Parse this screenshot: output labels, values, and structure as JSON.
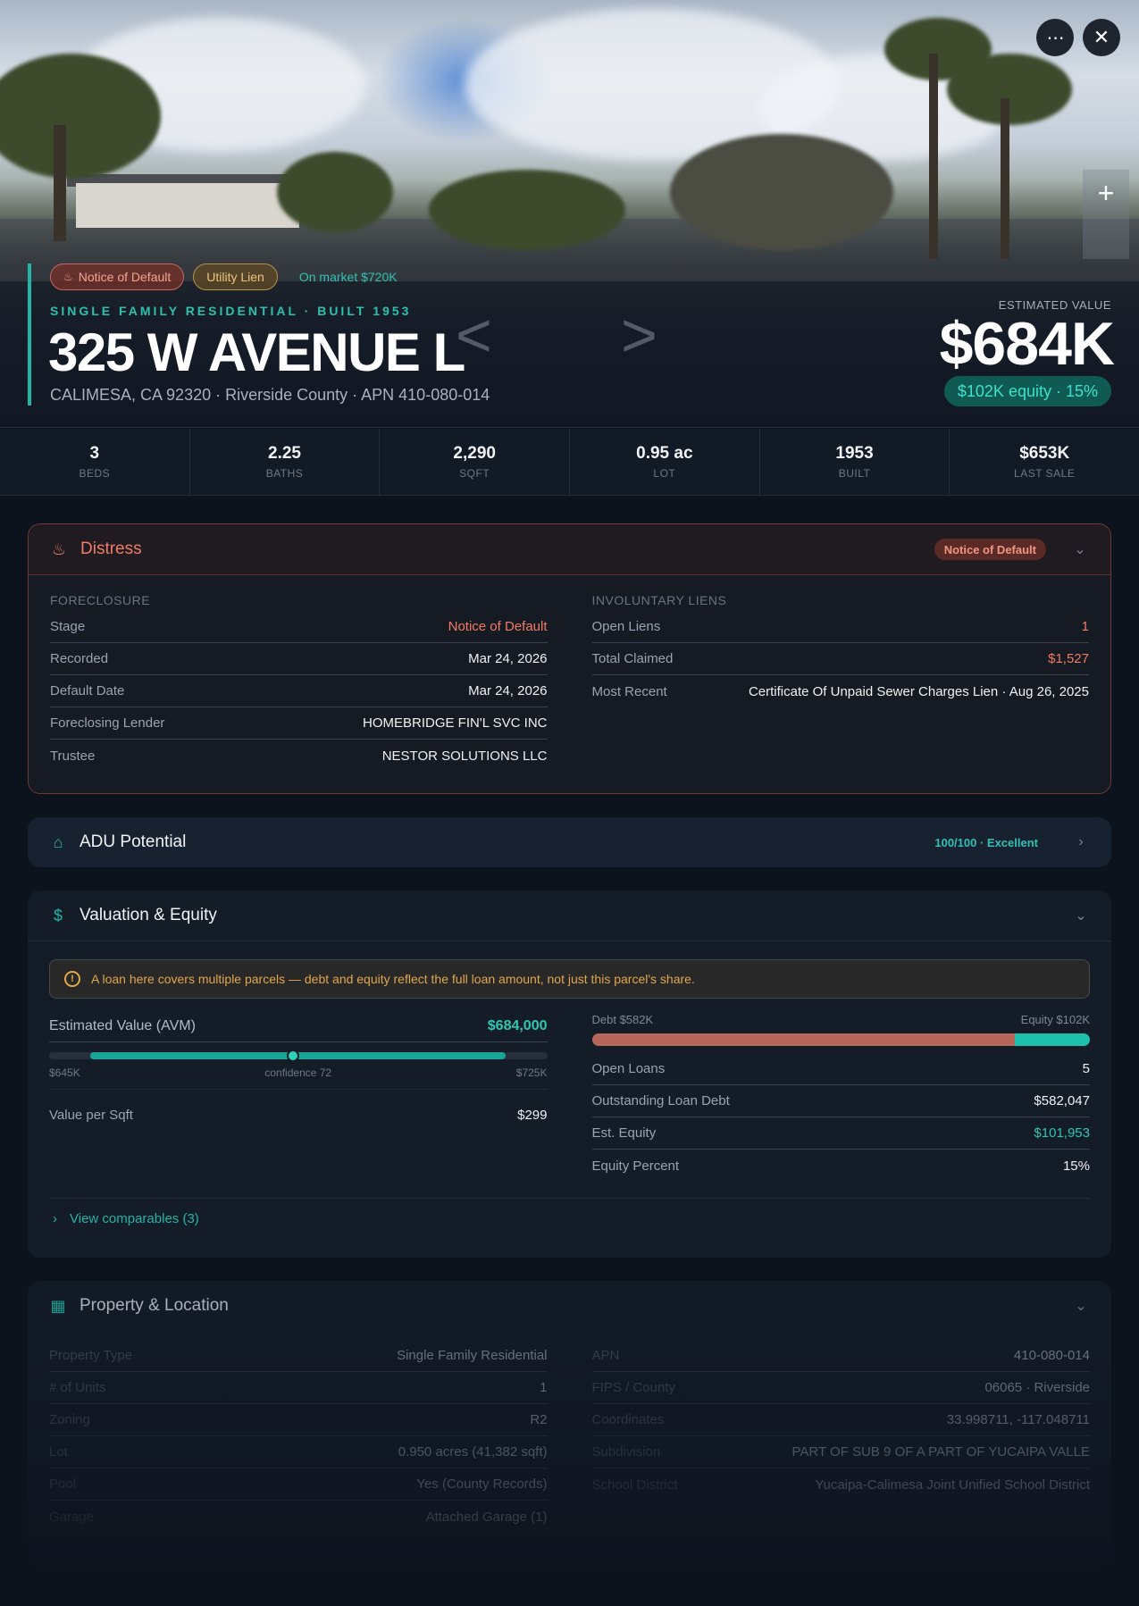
{
  "hero": {
    "badges": [
      "Notice of Default",
      "Utility Lien"
    ],
    "market_text": "On market $720K",
    "eyebrow": "SINGLE FAMILY RESIDENTIAL · BUILT 1953",
    "address": "325 W AVENUE L",
    "subaddress": "CALIMESA, CA 92320 · Riverside County · APN 410-080-014",
    "est_label": "ESTIMATED VALUE",
    "est_value": "$684K",
    "equity_pill": "$102K equity · 15%",
    "icons": [
      "more-icon",
      "close-icon",
      "zoom-in-icon",
      "flame-icon"
    ]
  },
  "stats": [
    {
      "value": "3",
      "label": "BEDS"
    },
    {
      "value": "2.25",
      "label": "BATHS"
    },
    {
      "value": "2,290",
      "label": "SQFT"
    },
    {
      "value": "0.95 ac",
      "label": "LOT"
    },
    {
      "value": "1953",
      "label": "BUILT"
    },
    {
      "value": "$653K",
      "label": "LAST SALE"
    }
  ],
  "distress": {
    "title": "Distress",
    "pill": "Notice of Default",
    "foreclosure_label": "FORECLOSURE",
    "foreclosure": [
      {
        "k": "Stage",
        "v": "Notice of Default"
      },
      {
        "k": "Recorded",
        "v": "Mar 24, 2026"
      },
      {
        "k": "Default Date",
        "v": "Mar 24, 2026"
      },
      {
        "k": "Foreclosing Lender",
        "v": "HOMEBRIDGE FIN'L SVC INC"
      },
      {
        "k": "Trustee",
        "v": "NESTOR SOLUTIONS LLC"
      }
    ],
    "liens_label": "INVOLUNTARY LIENS",
    "liens": [
      {
        "k": "Open Liens",
        "v": "1"
      },
      {
        "k": "Total Claimed",
        "v": "$1,527"
      },
      {
        "k": "Most Recent",
        "v": "Certificate Of Unpaid Sewer Charges Lien · Aug 26, 2025"
      }
    ]
  },
  "adu": {
    "title": "ADU Potential",
    "score": "100/100 · Excellent"
  },
  "valuation": {
    "title": "Valuation & Equity",
    "warning": "A loan here covers multiple parcels — debt and equity reflect the full loan amount, not just this parcel's share.",
    "avm_label": "Estimated Value (AVM)",
    "avm_value": "$684,000",
    "range_low": "$645K",
    "range_mid": "confidence 72",
    "range_high": "$725K",
    "range_low_num": 645,
    "range_high_num": 725,
    "estimate_num": 684,
    "confidence": 72,
    "value_per_sqft_label": "Value per Sqft",
    "value_per_sqft": "$299",
    "debt_label": "Debt $582K",
    "equity_label": "Equity $102K",
    "debt_fraction": 0.85,
    "rows": [
      {
        "k": "Open Loans",
        "v": "5"
      },
      {
        "k": "Outstanding Loan Debt",
        "v": "$582,047"
      },
      {
        "k": "Est. Equity",
        "v": "$101,953"
      },
      {
        "k": "Equity Percent",
        "v": "15%"
      }
    ],
    "comps_link": "View comparables (3)"
  },
  "property": {
    "title": "Property & Location",
    "left": [
      {
        "k": "Property Type",
        "v": "Single Family Residential"
      },
      {
        "k": "# of Units",
        "v": "1"
      },
      {
        "k": "Zoning",
        "v": "R2"
      },
      {
        "k": "Lot",
        "v": "0.950 acres (41,382 sqft)"
      },
      {
        "k": "Pool",
        "v": "Yes (County Records)"
      },
      {
        "k": "Garage",
        "v": "Attached Garage (1)"
      }
    ],
    "right": [
      {
        "k": "APN",
        "v": "410-080-014"
      },
      {
        "k": "FIPS / County",
        "v": "06065 · Riverside"
      },
      {
        "k": "Coordinates",
        "v": "33.998711, -117.048711"
      },
      {
        "k": "Subdivision",
        "v": "PART OF SUB 9 OF A PART OF YUCAIPA VALLE"
      },
      {
        "k": "School District",
        "v": "Yucaipa-Calimesa Joint Unified School District"
      }
    ]
  },
  "colors": {
    "accent": "#22b5a5",
    "distress": "#f07c67",
    "warning": "#e2a64d",
    "debt": "#b7675a",
    "equity": "#1fc0ad"
  }
}
